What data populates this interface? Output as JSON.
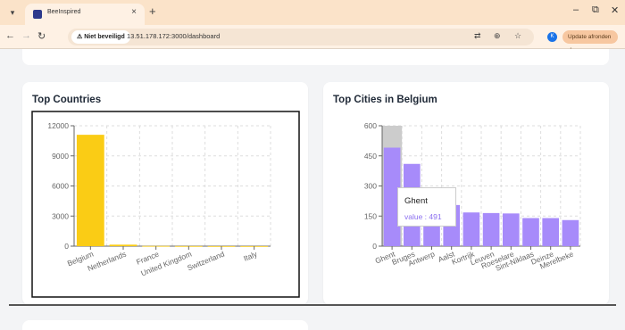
{
  "browser": {
    "tab_title": "BeeInspired",
    "tab_close": "×",
    "new_tab": "+",
    "security_label": "⚠ Niet beveiligd",
    "url": "13.51.178.172:3000/dashboard",
    "update_label": "Update afronden",
    "profile_initial": "K"
  },
  "dashboard": {
    "countries_title": "Top Countries",
    "cities_title": "Top Cities in Belgium",
    "tooltip": {
      "label": "Ghent",
      "value_text": "value : 491"
    }
  },
  "colors": {
    "countries_bar": "#facc15",
    "cities_bar": "#a78bfa",
    "cursor_band": "#cccccc"
  },
  "chart_data": [
    {
      "type": "bar",
      "title": "Top Countries",
      "categories": [
        "Belgium",
        "Netherlands",
        "France",
        "United Kingdom",
        "Switzerland",
        "Italy"
      ],
      "values": [
        11100,
        150,
        20,
        10,
        5,
        5
      ],
      "ylim": [
        0,
        12000
      ],
      "yticks": [
        0,
        3000,
        6000,
        9000,
        12000
      ],
      "grid": true
    },
    {
      "type": "bar",
      "title": "Top Cities in Belgium",
      "categories": [
        "Ghent",
        "Bruges",
        "Antwerp",
        "Aalst",
        "Kortrijk",
        "Leuven",
        "Roeselare",
        "Sint-Niklaas",
        "Deinze",
        "Merelbeke"
      ],
      "values": [
        491,
        410,
        285,
        205,
        168,
        165,
        163,
        140,
        140,
        130
      ],
      "ylim": [
        0,
        600
      ],
      "yticks": [
        0,
        150,
        300,
        450,
        600
      ],
      "grid": true
    }
  ]
}
